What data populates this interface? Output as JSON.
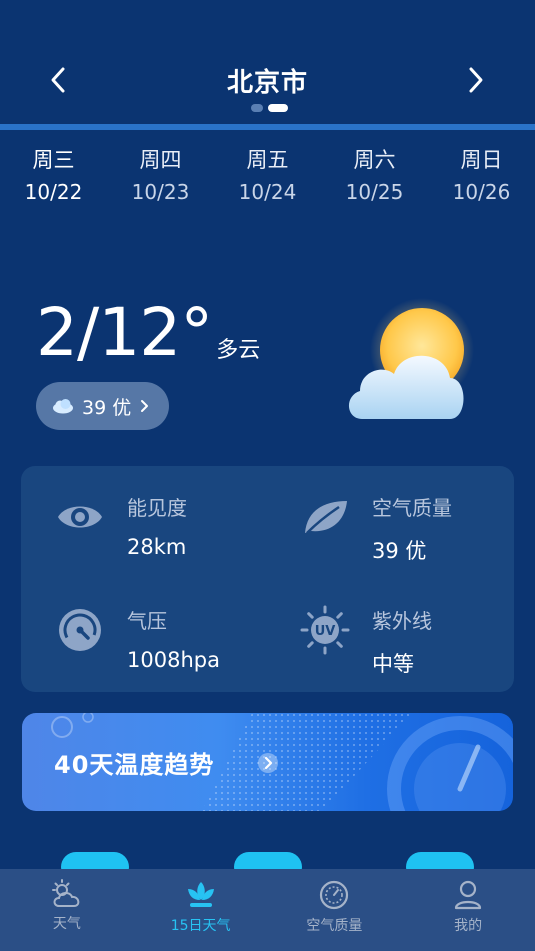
{
  "header": {
    "city": "北京市",
    "page_index": 1,
    "page_count": 2
  },
  "days": [
    {
      "weekday": "周三",
      "date": "10/22",
      "selected": true
    },
    {
      "weekday": "周四",
      "date": "10/23",
      "selected": false
    },
    {
      "weekday": "周五",
      "date": "10/24",
      "selected": false
    },
    {
      "weekday": "周六",
      "date": "10/25",
      "selected": false
    },
    {
      "weekday": "周日",
      "date": "10/26",
      "selected": false
    }
  ],
  "current": {
    "temp_range": "2/12°",
    "condition": "多云",
    "aqi_value": "39 优",
    "weather_icon": "partly-cloudy-icon"
  },
  "details": {
    "visibility": {
      "label": "能见度",
      "value": "28km",
      "icon": "eye-icon"
    },
    "air_quality": {
      "label": "空气质量",
      "value": "39 优",
      "icon": "leaf-icon"
    },
    "pressure": {
      "label": "气压",
      "value": "1008hpa",
      "icon": "gauge-icon"
    },
    "uv": {
      "label": "紫外线",
      "value": "中等",
      "icon": "uv-sun-icon"
    }
  },
  "banner": {
    "text": "40天温度趋势"
  },
  "tabs": [
    {
      "label": "天气",
      "icon": "cloud-sun-icon",
      "active": false
    },
    {
      "label": "15日天气",
      "icon": "lotus-icon",
      "active": true
    },
    {
      "label": "空气质量",
      "icon": "air-dial-icon",
      "active": false
    },
    {
      "label": "我的",
      "icon": "user-icon",
      "active": false
    }
  ],
  "colors": {
    "background": "#0b3471",
    "card": "#19467f",
    "accent": "#27c3f3",
    "tabbar": "#2b4f86"
  }
}
